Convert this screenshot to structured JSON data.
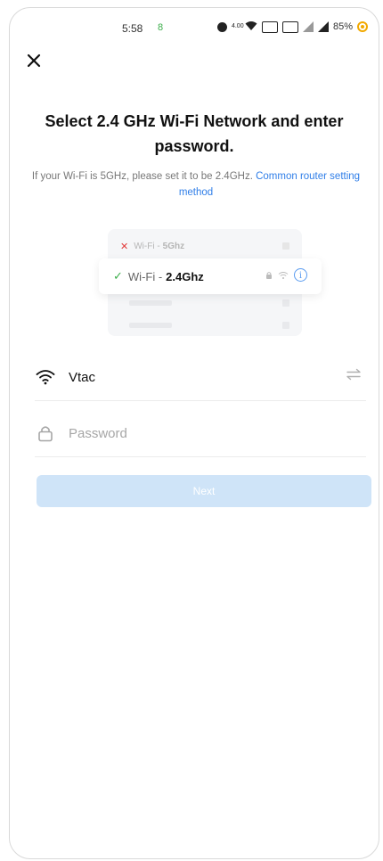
{
  "status_bar": {
    "time": "5:58",
    "extra": "8",
    "net_speed": "4.00",
    "battery": "85%"
  },
  "header": {
    "title": "Select 2.4 GHz Wi-Fi Network and enter password.",
    "subtitle": "If your Wi-Fi is 5GHz, please set it to be 2.4GHz.",
    "link_text": "Common router setting method"
  },
  "illustration": {
    "row_bad_prefix": "Wi-Fi -",
    "row_bad_band": "5Ghz",
    "row_good_prefix": "Wi-Fi -",
    "row_good_band": "2.4Ghz"
  },
  "form": {
    "ssid": "Vtac",
    "password_placeholder": "Password",
    "password_value": "",
    "next_label": "Next"
  },
  "colors": {
    "link": "#2f7ee8",
    "button_disabled": "#cfe4f8",
    "check": "#3cae4b",
    "cross": "#e23b3b",
    "info": "#5b9cf0"
  }
}
